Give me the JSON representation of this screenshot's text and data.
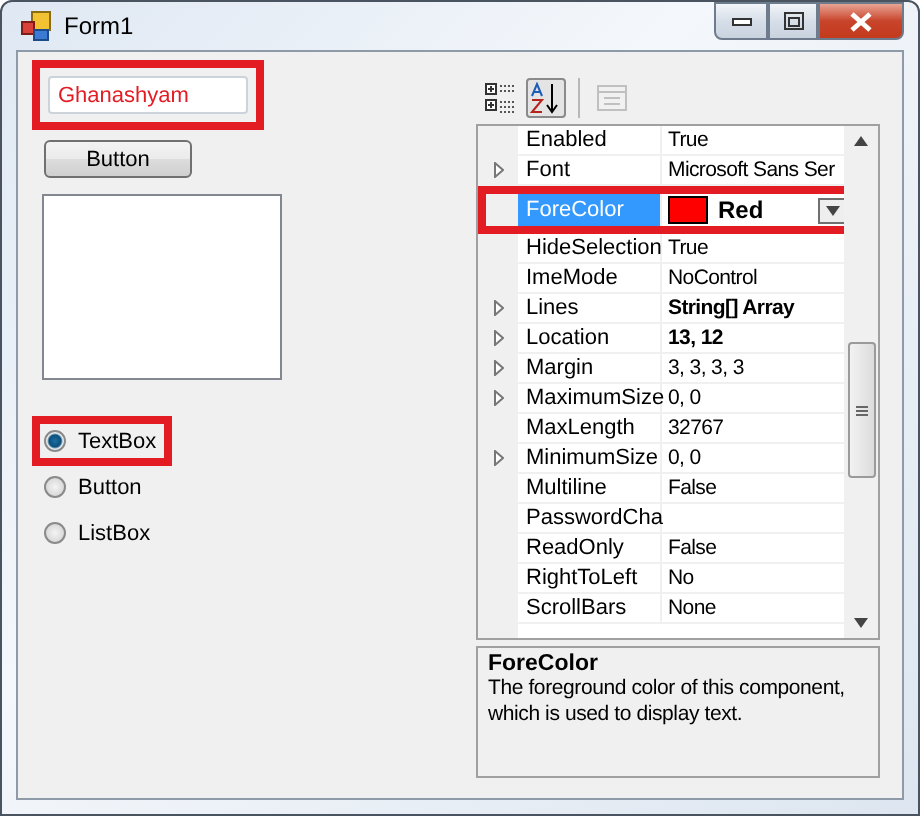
{
  "window": {
    "title": "Form1"
  },
  "form": {
    "textbox": {
      "value": "Ghanashyam",
      "highlighted": true
    },
    "button": {
      "label": "Button"
    },
    "radios": [
      {
        "label": "TextBox",
        "selected": true,
        "highlighted": true
      },
      {
        "label": "Button",
        "selected": false,
        "highlighted": false
      },
      {
        "label": "ListBox",
        "selected": false,
        "highlighted": false
      }
    ]
  },
  "property_grid": {
    "toolbar": [
      {
        "kind": "categorized",
        "selected": false,
        "disabled": false
      },
      {
        "kind": "alphabetical",
        "selected": true,
        "disabled": false
      },
      {
        "kind": "pages",
        "selected": false,
        "disabled": true
      }
    ],
    "rows": [
      {
        "kind": "text",
        "name": "Enabled",
        "value": "True",
        "expandable": false,
        "bold": false,
        "selected": false,
        "highlighted": false
      },
      {
        "kind": "text",
        "name": "Font",
        "value": "Microsoft Sans Ser",
        "expandable": true,
        "bold": false,
        "selected": false,
        "highlighted": false
      },
      {
        "kind": "color",
        "name": "ForeColor",
        "value": "Red",
        "color": "#ff0000",
        "expandable": false,
        "bold": true,
        "selected": true,
        "highlighted": true
      },
      {
        "kind": "text",
        "name": "HideSelection",
        "value": "True",
        "expandable": false,
        "bold": false,
        "selected": false,
        "highlighted": false
      },
      {
        "kind": "text",
        "name": "ImeMode",
        "value": "NoControl",
        "expandable": false,
        "bold": false,
        "selected": false,
        "highlighted": false
      },
      {
        "kind": "text",
        "name": "Lines",
        "value": "String[] Array",
        "expandable": true,
        "bold": true,
        "selected": false,
        "highlighted": false
      },
      {
        "kind": "text",
        "name": "Location",
        "value": "13, 12",
        "expandable": true,
        "bold": true,
        "selected": false,
        "highlighted": false
      },
      {
        "kind": "text",
        "name": "Margin",
        "value": "3, 3, 3, 3",
        "expandable": true,
        "bold": false,
        "selected": false,
        "highlighted": false
      },
      {
        "kind": "text",
        "name": "MaximumSize",
        "value": "0, 0",
        "expandable": true,
        "bold": false,
        "selected": false,
        "highlighted": false
      },
      {
        "kind": "text",
        "name": "MaxLength",
        "value": "32767",
        "expandable": false,
        "bold": false,
        "selected": false,
        "highlighted": false
      },
      {
        "kind": "text",
        "name": "MinimumSize",
        "value": "0, 0",
        "expandable": true,
        "bold": false,
        "selected": false,
        "highlighted": false
      },
      {
        "kind": "text",
        "name": "Multiline",
        "value": "False",
        "expandable": false,
        "bold": false,
        "selected": false,
        "highlighted": false
      },
      {
        "kind": "text",
        "name": "PasswordCha",
        "expandable": false,
        "selected": false,
        "highlighted": false
      },
      {
        "kind": "text",
        "name": "ReadOnly",
        "value": "False",
        "expandable": false,
        "bold": false,
        "selected": false,
        "highlighted": false
      },
      {
        "kind": "text",
        "name": "RightToLeft",
        "value": "No",
        "expandable": false,
        "bold": false,
        "selected": false,
        "highlighted": false
      },
      {
        "kind": "text",
        "name": "ScrollBars",
        "value": "None",
        "expandable": false,
        "bold": false,
        "selected": false,
        "highlighted": false
      }
    ],
    "description": {
      "title": "ForeColor",
      "text": "The foreground color of this component, which is used to display text."
    }
  }
}
